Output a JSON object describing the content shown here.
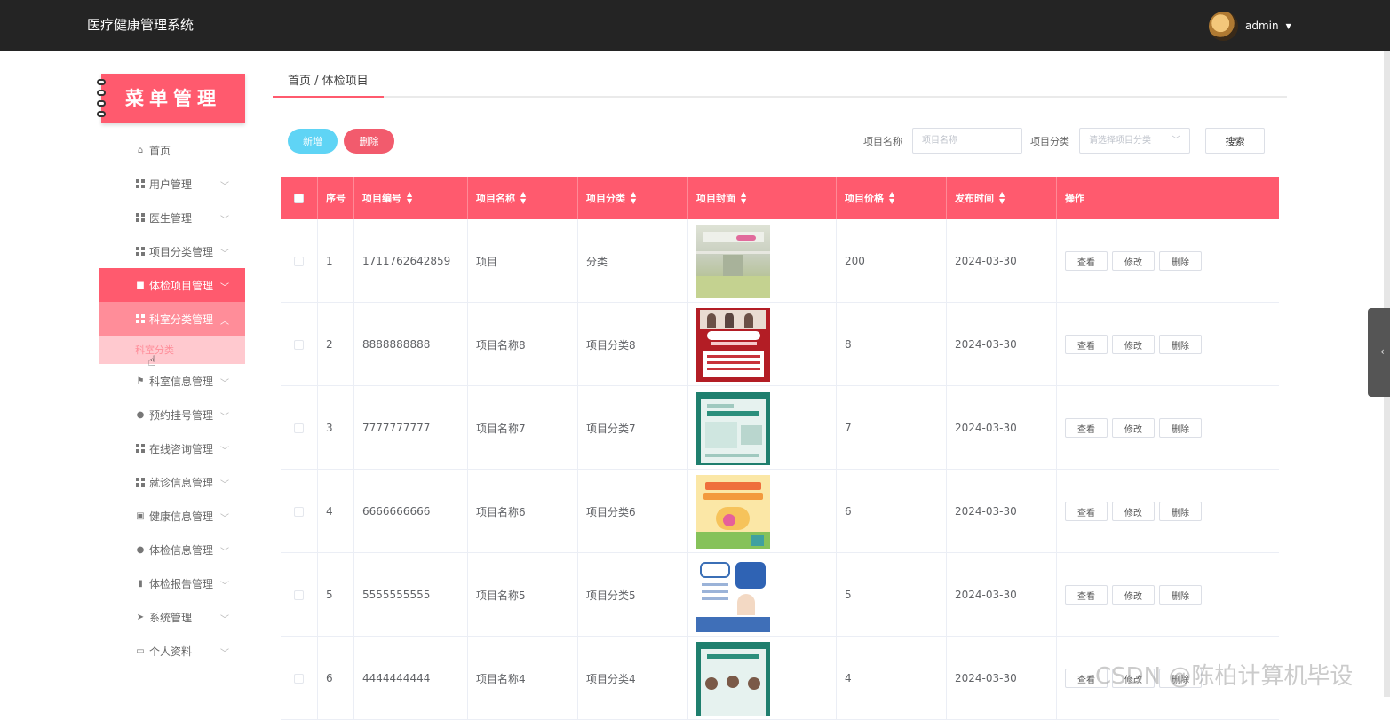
{
  "app": {
    "title": "医疗健康管理系统"
  },
  "user": {
    "name": "admin"
  },
  "menu_banner": "菜单管理",
  "menu": [
    {
      "label": "首页"
    },
    {
      "label": "用户管理"
    },
    {
      "label": "医生管理"
    },
    {
      "label": "项目分类管理"
    },
    {
      "label": "体检项目管理"
    },
    {
      "label": "科室分类管理"
    },
    {
      "label": "科室分类"
    },
    {
      "label": "科室信息管理"
    },
    {
      "label": "预约挂号管理"
    },
    {
      "label": "在线咨询管理"
    },
    {
      "label": "就诊信息管理"
    },
    {
      "label": "健康信息管理"
    },
    {
      "label": "体检信息管理"
    },
    {
      "label": "体检报告管理"
    },
    {
      "label": "系统管理"
    },
    {
      "label": "个人资料"
    }
  ],
  "breadcrumb": "首页 / 体检项目",
  "toolbar": {
    "add": "新增",
    "delete": "删除"
  },
  "search": {
    "name_label": "项目名称",
    "name_placeholder": "项目名称",
    "category_label": "项目分类",
    "category_placeholder": "请选择项目分类",
    "button": "搜索"
  },
  "table": {
    "headers": [
      "序号",
      "项目编号",
      "项目名称",
      "项目分类",
      "项目封面",
      "项目价格",
      "发布时间",
      "操作"
    ],
    "actions": {
      "view": "查看",
      "edit": "修改",
      "delete": "删除"
    },
    "rows": [
      {
        "index": "1",
        "code": "1711762642859",
        "name": "项目",
        "category": "分类",
        "price": "200",
        "date": "2024-03-30"
      },
      {
        "index": "2",
        "code": "8888888888",
        "name": "项目名称8",
        "category": "项目分类8",
        "price": "8",
        "date": "2024-03-30"
      },
      {
        "index": "3",
        "code": "7777777777",
        "name": "项目名称7",
        "category": "项目分类7",
        "price": "7",
        "date": "2024-03-30"
      },
      {
        "index": "4",
        "code": "6666666666",
        "name": "项目名称6",
        "category": "项目分类6",
        "price": "6",
        "date": "2024-03-30"
      },
      {
        "index": "5",
        "code": "5555555555",
        "name": "项目名称5",
        "category": "项目分类5",
        "price": "5",
        "date": "2024-03-30"
      },
      {
        "index": "6",
        "code": "4444444444",
        "name": "项目名称4",
        "category": "项目分类4",
        "price": "4",
        "date": "2024-03-30"
      }
    ]
  },
  "watermark": "CSDN @陈柏计算机毕设",
  "colors": {
    "topbar": "#242424",
    "accent": "#ff5a6e",
    "accent_light": "#ff8d99",
    "add_button": "#5fd4f5"
  }
}
